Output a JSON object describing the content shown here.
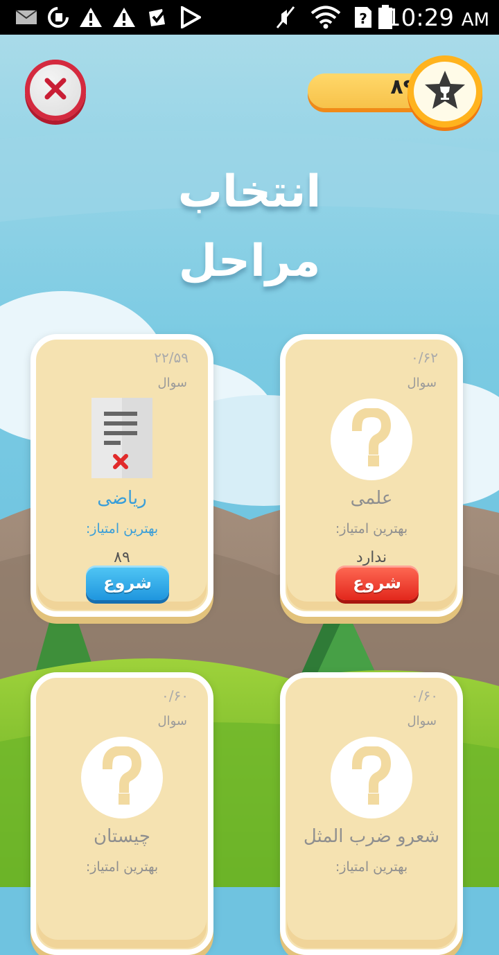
{
  "status_bar": {
    "time": "10:29",
    "ampm": "AM",
    "icons": [
      "mail-icon",
      "sync-icon",
      "warning-icon",
      "warning-icon",
      "checkbox-icon",
      "play-store-icon",
      "mute-icon",
      "wifi-icon",
      "unknown-sim-icon",
      "battery-icon"
    ]
  },
  "header": {
    "score": "۸۹",
    "close_icon": "close-icon",
    "star_icon": "trophy-star-icon"
  },
  "title": {
    "line1": "انتخاب",
    "line2": "مراحل"
  },
  "levels": [
    {
      "count": "۲۲/۵۹",
      "question_label": "سوال",
      "name": "ریاضی",
      "best_label": "بهترین امتیاز:",
      "best_value": "۸۹",
      "start_label": "شروع",
      "icon": "document-icon",
      "button_color": "#1f96de"
    },
    {
      "count": "۰/۶۲",
      "question_label": "سوال",
      "name": "علمی",
      "best_label": "بهترین امتیاز:",
      "best_value": "ندارد",
      "start_label": "شروع",
      "icon": "question-icon",
      "button_color": "#e2271c"
    },
    {
      "count": "۰/۶۰",
      "question_label": "سوال",
      "name": "چیستان",
      "best_label": "بهترین امتیاز:",
      "icon": "question-icon"
    },
    {
      "count": "۰/۶۰",
      "question_label": "سوال",
      "name": "شعرو ضرب المثل",
      "best_label": "بهترین امتیاز:",
      "icon": "question-icon"
    }
  ]
}
